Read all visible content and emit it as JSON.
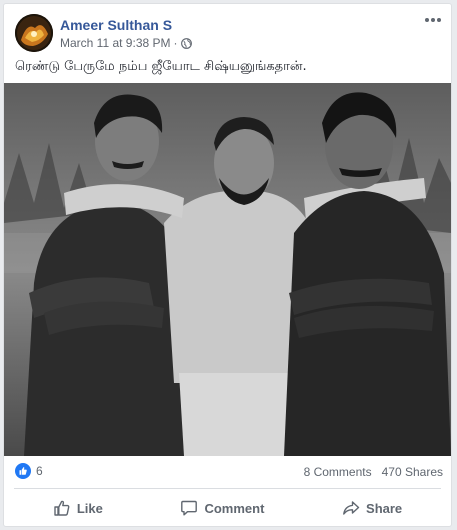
{
  "post": {
    "author": "Ameer Sulthan S",
    "timestamp": "March 11 at 9:38 PM",
    "separator": "·",
    "privacy_icon": "globe-icon",
    "text": "ரெண்டு பேருமே நம்ப ஜீயோட சிஷ்யனுங்கதான்."
  },
  "stats": {
    "reaction_count": "6",
    "comments": "8 Comments",
    "shares": "470 Shares"
  },
  "actions": {
    "like": "Like",
    "comment": "Comment",
    "share": "Share"
  },
  "colors": {
    "name_link": "#365899",
    "like_blue": "#2078f4",
    "muted": "#606770"
  }
}
